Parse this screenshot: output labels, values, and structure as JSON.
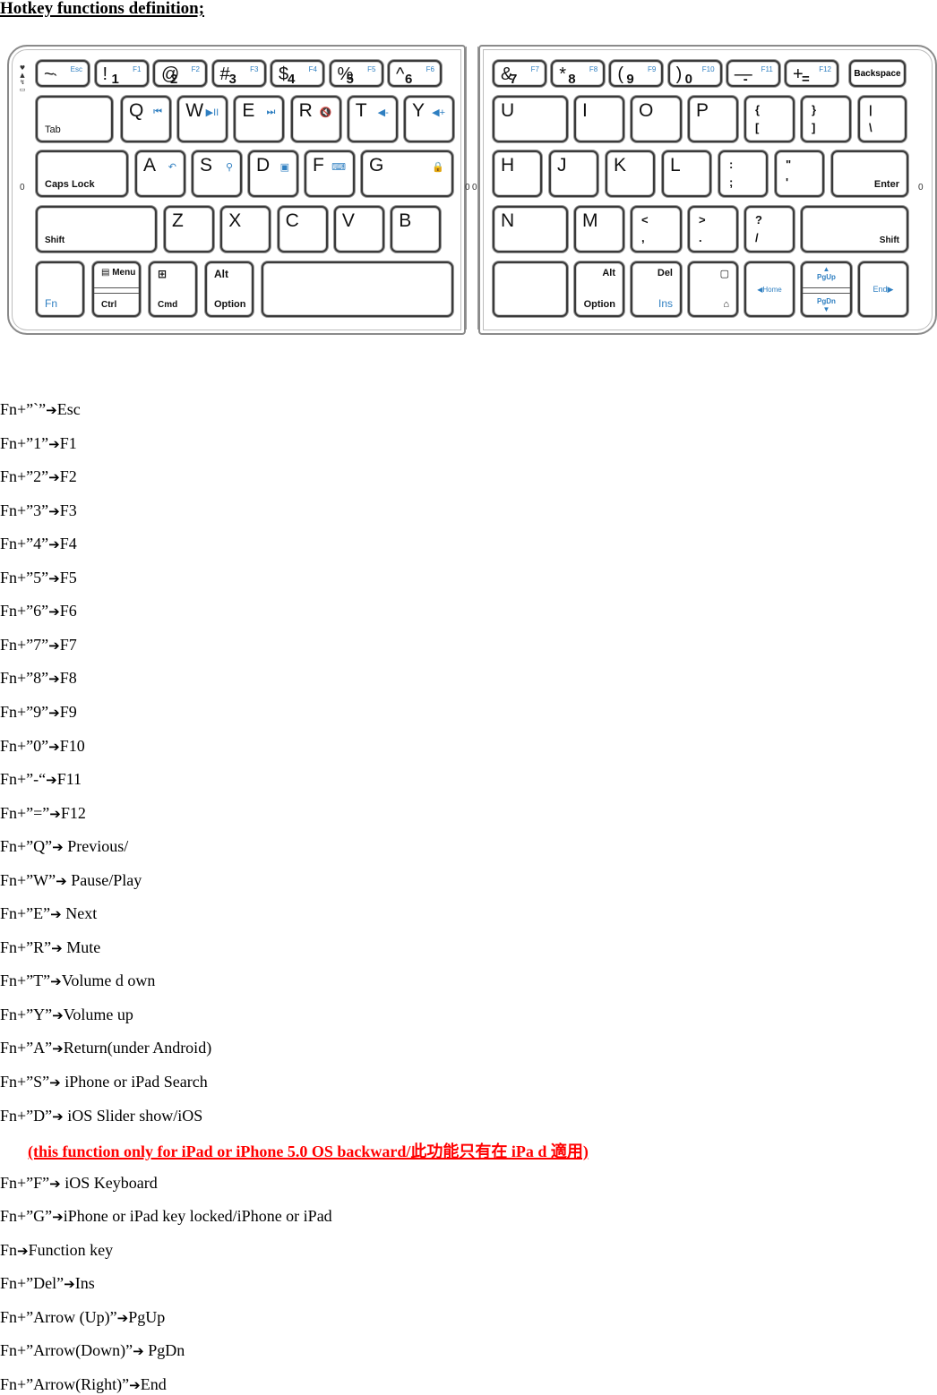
{
  "title": "Hotkey functions definition;",
  "keyboard": {
    "row1_left": [
      {
        "main": "~",
        "sub": "`",
        "fn": "Esc"
      },
      {
        "main": "!",
        "sub": "1",
        "fn": "F1"
      },
      {
        "main": "@",
        "sub": "2",
        "fn": "F2"
      },
      {
        "main": "#",
        "sub": "3",
        "fn": "F3"
      },
      {
        "main": "$",
        "sub": "4",
        "fn": "F4"
      },
      {
        "main": "%",
        "sub": "5",
        "fn": "F5"
      },
      {
        "main": "^",
        "sub": "6",
        "fn": "F6"
      }
    ],
    "row1_right": [
      {
        "main": "&",
        "sub": "7",
        "fn": "F7"
      },
      {
        "main": "*",
        "sub": "8",
        "fn": "F8"
      },
      {
        "main": "(",
        "sub": "9",
        "fn": "F9"
      },
      {
        "main": ")",
        "sub": "0",
        "fn": "F10"
      },
      {
        "main": "—",
        "sub": "-",
        "fn": "F11"
      },
      {
        "main": "+",
        "sub": "=",
        "fn": "F12"
      }
    ],
    "backspace": "Backspace",
    "tab": "Tab",
    "row2_left": [
      {
        "main": "Q",
        "icon": "⏮"
      },
      {
        "main": "W",
        "icon": "▶II"
      },
      {
        "main": "E",
        "icon": "⏭"
      },
      {
        "main": "R",
        "icon": "🔇"
      },
      {
        "main": "T",
        "icon": "◀-"
      },
      {
        "main": "Y",
        "icon": "◀+"
      }
    ],
    "row2_right": [
      {
        "main": "U"
      },
      {
        "main": "I"
      },
      {
        "main": "O"
      },
      {
        "main": "P"
      },
      {
        "sym1": "{",
        "sym2": "["
      },
      {
        "sym1": "}",
        "sym2": "]"
      },
      {
        "sym1": "|",
        "sym2": "\\"
      }
    ],
    "caps_lock": "Caps Lock",
    "row3_left": [
      {
        "main": "A",
        "icon": "↶"
      },
      {
        "main": "S",
        "icon": "⚲"
      },
      {
        "main": "D",
        "icon": "▣"
      },
      {
        "main": "F",
        "icon": "⌨"
      },
      {
        "main": "G",
        "icon": "🔒"
      }
    ],
    "row3_right": [
      {
        "main": "H"
      },
      {
        "main": "J"
      },
      {
        "main": "K"
      },
      {
        "main": "L"
      },
      {
        "sym1": ":",
        "sym2": ";"
      },
      {
        "sym1": "\"",
        "sym2": "'"
      }
    ],
    "enter": "Enter",
    "shift_left": "Shift",
    "row4_left": [
      {
        "main": "Z"
      },
      {
        "main": "X"
      },
      {
        "main": "C"
      },
      {
        "main": "V"
      },
      {
        "main": "B"
      }
    ],
    "row4_right": [
      {
        "main": "N"
      },
      {
        "main": "M"
      },
      {
        "sym1": "<",
        "sym2": ","
      },
      {
        "sym1": ">",
        "sym2": "."
      },
      {
        "sym1": "?",
        "sym2": "/"
      }
    ],
    "shift_right": "Shift",
    "fn": "Fn",
    "menu": "Menu",
    "ctrl": "Ctrl",
    "cmd": "Cmd",
    "alt": "Alt",
    "option": "Option",
    "del": "Del",
    "ins": "Ins",
    "home": "◀Home",
    "pgup": "PgUp",
    "pgdn": "PgDn",
    "end": "End▶",
    "side_mark": "0",
    "accent_color": "#2f7fc1"
  },
  "arrow": "➔",
  "hotkeys": [
    {
      "combo": "Fn+”`”",
      "result": "Esc"
    },
    {
      "combo": "Fn+”1”",
      "result": "F1"
    },
    {
      "combo": "Fn+”2”",
      "result": "F2"
    },
    {
      "combo": "Fn+”3”",
      "result": "F3"
    },
    {
      "combo": "Fn+”4”",
      "result": "F4"
    },
    {
      "combo": "Fn+”5”",
      "result": "F5"
    },
    {
      "combo": "Fn+”6”",
      "result": "F6"
    },
    {
      "combo": "Fn+”7”",
      "result": "F7"
    },
    {
      "combo": "Fn+”8”",
      "result": "F8"
    },
    {
      "combo": "Fn+”9”",
      "result": "F9"
    },
    {
      "combo": "Fn+”0”",
      "result": "F10"
    },
    {
      "combo": "Fn+”-“",
      "result": "F11"
    },
    {
      "combo": "Fn+”=”",
      "result": "F12"
    },
    {
      "combo": "Fn+”Q”",
      "result": " Previous/"
    },
    {
      "combo": "Fn+”W”",
      "result": " Pause/Play"
    },
    {
      "combo": "Fn+”E”",
      "result": " Next"
    },
    {
      "combo": "Fn+”R”",
      "result": " Mute"
    },
    {
      "combo": "Fn+”T”",
      "result": "Volume d own"
    },
    {
      "combo": "Fn+”Y”",
      "result": "Volume up"
    },
    {
      "combo": "Fn+”A”",
      "result": "Return(under Android)"
    },
    {
      "combo": "Fn+”S”",
      "result": " iPhone or iPad Search"
    },
    {
      "combo": "Fn+”D”",
      "result": " iOS Slider show/iOS"
    },
    {
      "combo": "Fn+”F”",
      "result": " iOS Keyboard"
    },
    {
      "combo": "Fn+”G”",
      "result": "iPhone or iPad key locked/iPhone or iPad"
    },
    {
      "combo": "Fn",
      "result": "Function key"
    },
    {
      "combo": "Fn+”Del”",
      "result": "Ins"
    },
    {
      "combo": "Fn+”Arrow (Up)”",
      "result": "PgUp"
    },
    {
      "combo": "Fn+”Arrow(Down)”",
      "result": " PgDn"
    },
    {
      "combo": "Fn+”Arrow(Right)”",
      "result": "End"
    }
  ],
  "note": "(this function only for iPad or iPhone 5.0 OS backward/此功能只有在 iPa d 適用)",
  "note_color": "#ff0000"
}
